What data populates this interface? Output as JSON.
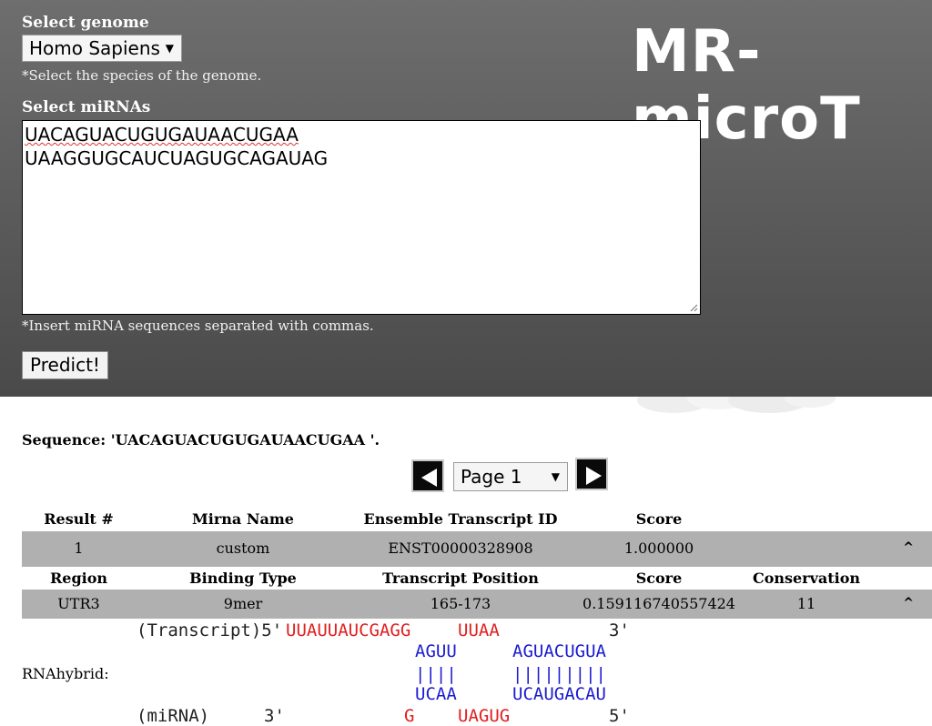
{
  "form": {
    "genome_label": "Select genome",
    "genome_value": "Homo Sapiens",
    "genome_hint": "*Select the species of the genome.",
    "mirna_label": "Select miRNAs",
    "mirna_lines": [
      "UACAGUACUGUGAUAACUGAA",
      "UAAGGUGCAUCUAGUGCAGAUAG"
    ],
    "mirna_hint": "*Insert miRNA sequences separated with commas.",
    "predict_label": "Predict!"
  },
  "logo": "MR-microT",
  "results": {
    "sequence_text": "Sequence: 'UACAGUACUGUGAUAACUGAA '.",
    "page_value": "Page 1",
    "main_headers": [
      "Result #",
      "Mirna Name",
      "Ensemble Transcript ID",
      "Score"
    ],
    "main_row": [
      "1",
      "custom",
      "ENST00000328908",
      "1.000000"
    ],
    "detail_headers": [
      "Region",
      "Binding Type",
      "Transcript Position",
      "Score",
      "Conservation"
    ],
    "detail_row": [
      "UTR3",
      "9mer",
      "165-173",
      "0.159116740557424",
      "11"
    ],
    "caret": "^"
  },
  "rnahybrid": {
    "label": "RNAhybrid:",
    "transcript_prefix": "(Transcript)5'",
    "transcript_seg1": "UUAUUAUCGAGG",
    "transcript_seg2": "UUAA",
    "transcript_end": "3'",
    "upper_pair1": "AGUU",
    "upper_pair2": "AGUACUGUA",
    "bonds1": "||||",
    "bonds2": "|||||||||",
    "lower_pair1": "UCAA",
    "lower_pair2": "UCAUGACAU",
    "mirna_prefix": "(miRNA)",
    "mirna_3": "3'",
    "mirna_seg1": "G",
    "mirna_seg2": "UAGUG",
    "mirna_end": "5'"
  },
  "colors": {
    "unpaired": "#e02020",
    "paired": "#1c1cd0"
  }
}
